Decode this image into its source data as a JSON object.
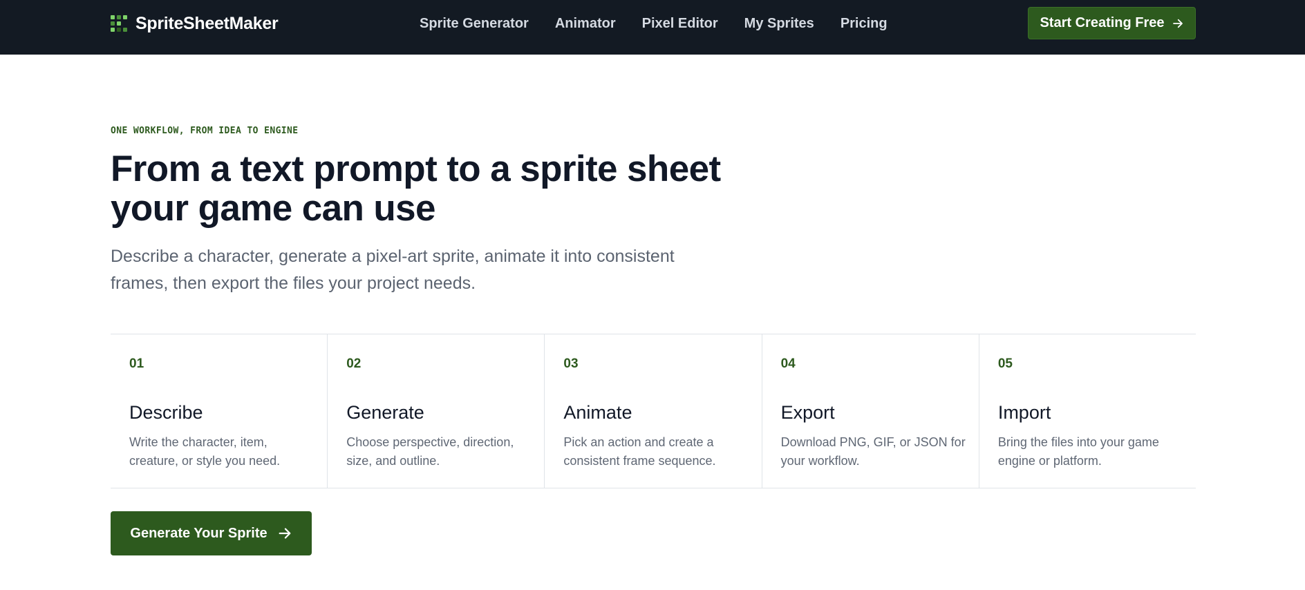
{
  "brand": {
    "name": "SpriteSheetMaker",
    "logo_icon": "pixel-grid-icon",
    "logo_colors": [
      "#7fd36a",
      "#4a8f3a",
      "#2d5a1e"
    ]
  },
  "nav": {
    "items": [
      {
        "label": "Sprite Generator"
      },
      {
        "label": "Animator"
      },
      {
        "label": "Pixel Editor"
      },
      {
        "label": "My Sprites"
      },
      {
        "label": "Pricing"
      }
    ],
    "cta_label": "Start Creating Free",
    "cta_icon": "arrow-right-icon"
  },
  "hero": {
    "eyebrow": "ONE WORKFLOW, FROM IDEA TO ENGINE",
    "title": "From a text prompt to a sprite sheet your game can use",
    "subtitle": "Describe a character, generate a pixel-art sprite, animate it into consistent frames, then export the files your project needs."
  },
  "steps": [
    {
      "number": "01",
      "title": "Describe",
      "description": "Write the character, item, creature, or style you need."
    },
    {
      "number": "02",
      "title": "Generate",
      "description": "Choose perspective, direction, size, and outline."
    },
    {
      "number": "03",
      "title": "Animate",
      "description": "Pick an action and create a consistent frame sequence."
    },
    {
      "number": "04",
      "title": "Export",
      "description": "Download PNG, GIF, or JSON for your workflow."
    },
    {
      "number": "05",
      "title": "Import",
      "description": "Bring the files into your game engine or platform."
    }
  ],
  "main_cta": {
    "label": "Generate Your Sprite",
    "icon": "arrow-right-icon"
  },
  "colors": {
    "header_bg": "#131a23",
    "accent": "#2d5a1e",
    "accent_light": "#7fd36a",
    "body_text": "#111827",
    "muted_text": "#5b6370",
    "border": "#dfe3e8"
  }
}
